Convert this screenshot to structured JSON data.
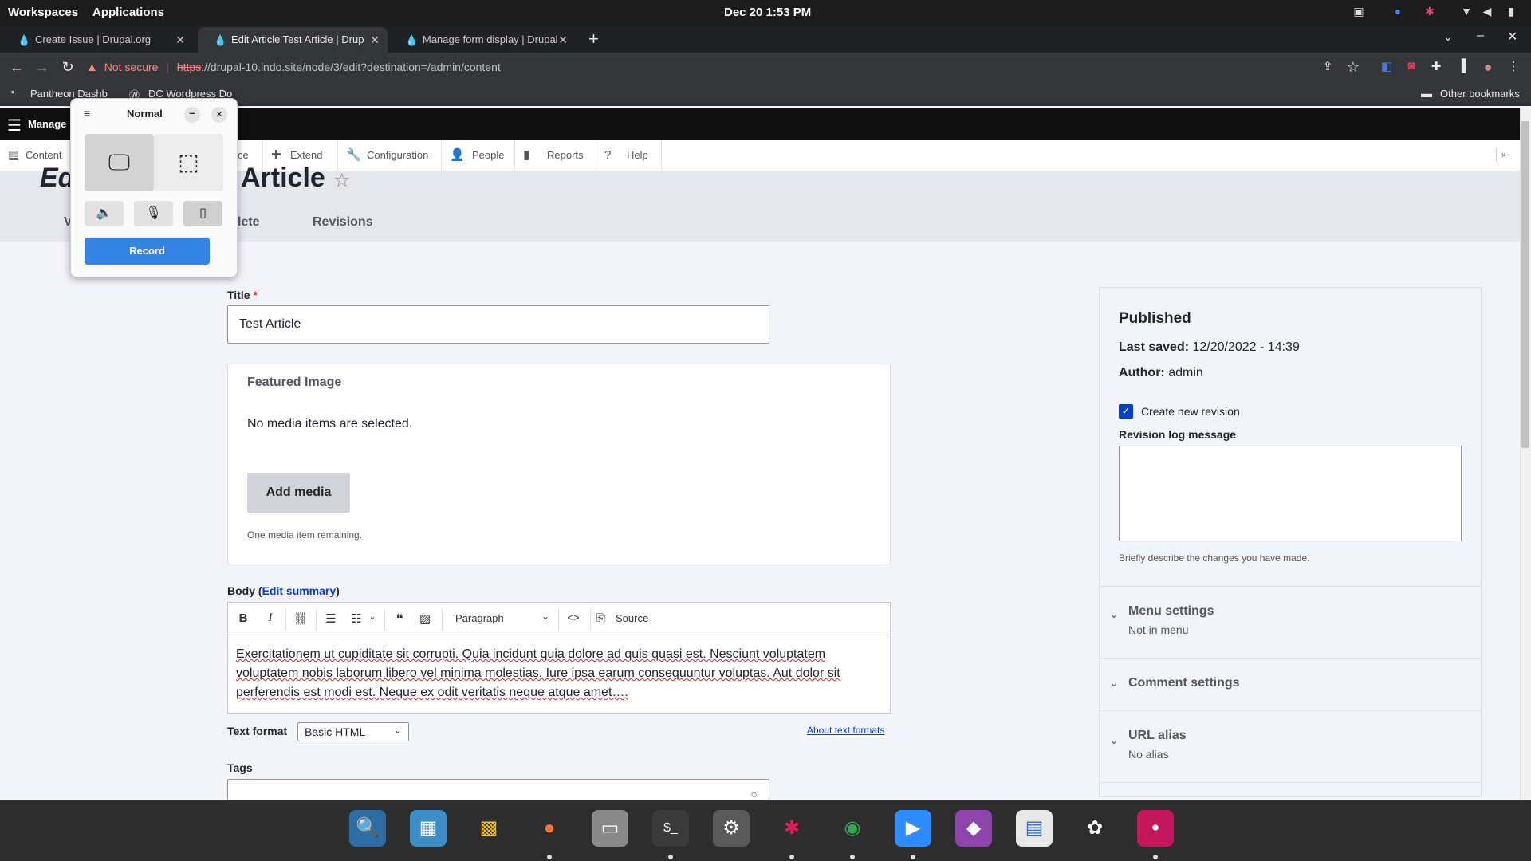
{
  "desktop": {
    "workspaces": "Workspaces",
    "applications": "Applications",
    "clock": "Dec 20  1:53 PM"
  },
  "browser": {
    "tabs": [
      {
        "label": "Create Issue | Drupal.org"
      },
      {
        "label": "Edit Article Test Article | Drup"
      },
      {
        "label": "Manage form display | Drupal"
      }
    ],
    "security": "Not secure",
    "url_scheme": "https",
    "url_rest": "://drupal-10.lndo.site/node/3/edit?destination=/admin/content",
    "bookmarks": [
      "Pantheon Dashb",
      "DC Wordpress Do"
    ],
    "other_bookmarks": "Other bookmarks"
  },
  "admin": {
    "manage": "Manage",
    "tray": [
      "Content",
      "ce",
      "Extend",
      "Configuration",
      "People",
      "Reports",
      "Help"
    ]
  },
  "page": {
    "title_start": "Ed",
    "title_end": "Article",
    "tabs": [
      "V",
      "lete",
      "Revisions"
    ]
  },
  "form": {
    "title_label": "Title",
    "required": "*",
    "title_value": "Test Article",
    "featured_image": {
      "label": "Featured Image",
      "empty": "No media items are selected.",
      "add_media": "Add media",
      "remaining": "One media item remaining."
    },
    "body": {
      "label": "Body",
      "edit_summary": "Edit summary",
      "paragraph": "Paragraph",
      "source": "Source",
      "text": "Exercitationem ut cupiditate sit corrupti. Quia incidunt quia dolore ad quis quasi est. Nesciunt voluptatem voluptatem nobis laborum libero vel minima molestias. Iure ipsa earum consequuntur voluptas. Aut dolor sit perferendis est modi est. Neque ex odit veritatis neque atque amet…."
    },
    "text_format_label": "Text format",
    "text_format_value": "Basic HTML",
    "about_formats": "About text formats",
    "tags_label": "Tags"
  },
  "sidebar": {
    "status": "Published",
    "last_saved_label": "Last saved:",
    "last_saved_value": "12/20/2022 - 14:39",
    "author_label": "Author:",
    "author_value": "admin",
    "create_revision": "Create new revision",
    "revision_log_label": "Revision log message",
    "revision_help": "Briefly describe the changes you have made.",
    "sections": [
      {
        "title": "Menu settings",
        "sub": "Not in menu"
      },
      {
        "title": "Comment settings",
        "sub": ""
      },
      {
        "title": "URL alias",
        "sub": "No alias"
      }
    ]
  },
  "recorder": {
    "mode": "Normal",
    "record": "Record"
  },
  "colors": {
    "accent": "#003ecc",
    "record_button": "#3584e4",
    "checkbox": "#003ecc",
    "required": "#d72222"
  }
}
